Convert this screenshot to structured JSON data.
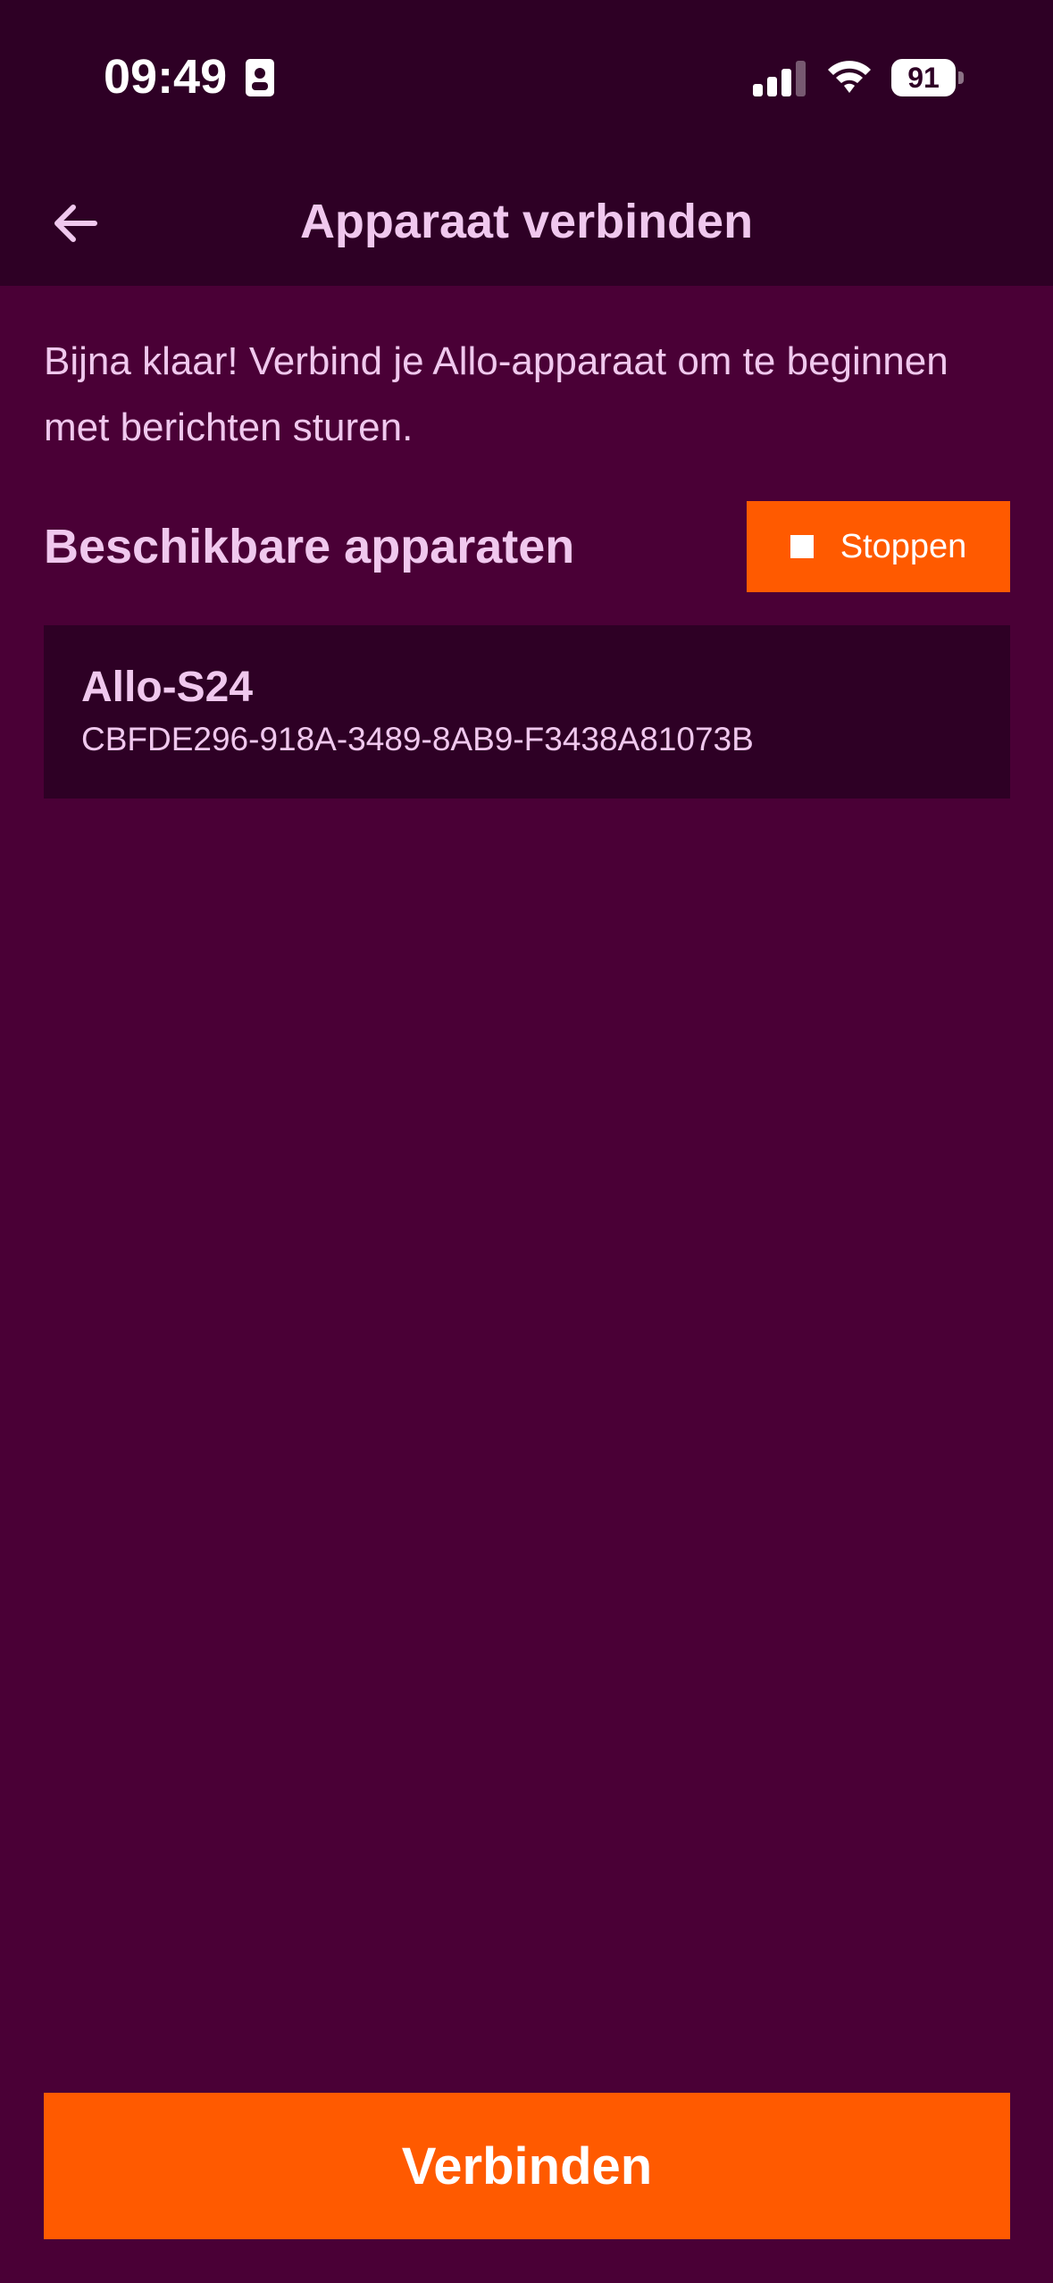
{
  "status_bar": {
    "time": "09:49",
    "battery_level": "91",
    "icons": [
      "id-badge-icon",
      "cellular-signal-icon",
      "wifi-icon",
      "battery-icon"
    ]
  },
  "nav": {
    "title": "Apparaat verbinden",
    "back_icon": "arrow-left-icon"
  },
  "main": {
    "intro_text": "Bijna klaar! Verbind je Allo-apparaat om te beginnen met berichten sturen.",
    "section_title": "Beschikbare apparaten",
    "stop_button_label": "Stoppen",
    "stop_icon": "stop-square-icon",
    "devices": [
      {
        "name": "Allo-S24",
        "id": "CBFDE296-918A-3489-8AB9-F3438A81073B"
      }
    ]
  },
  "footer": {
    "connect_label": "Verbinden"
  },
  "colors": {
    "background": "#4a0036",
    "header": "#2e0025",
    "accent": "#ff5a00",
    "text": "#f0c8ee"
  }
}
